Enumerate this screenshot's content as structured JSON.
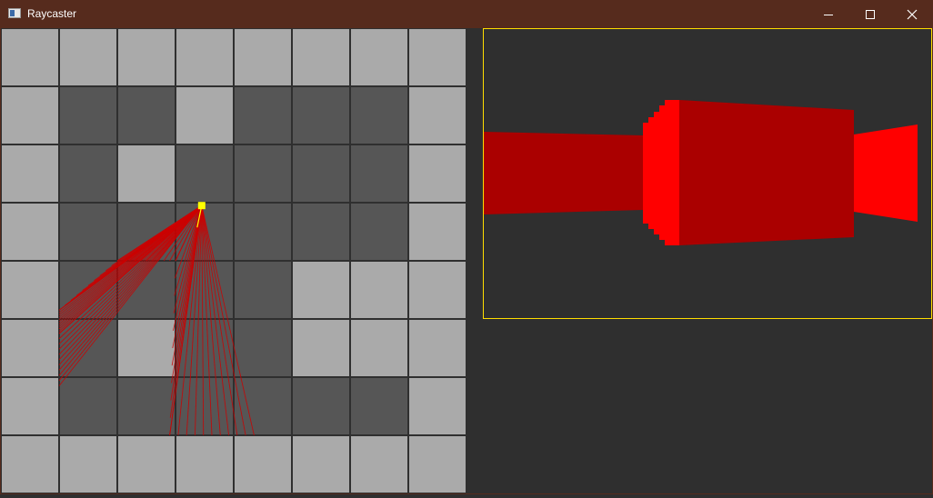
{
  "window": {
    "title": "Raycaster",
    "controls": {
      "minimize": "minimize-icon",
      "maximize": "maximize-icon",
      "close": "close-icon"
    }
  },
  "colors": {
    "titlebar": "#562b1d",
    "background": "#2f2f2f",
    "wall_cell": "#aaaaaa",
    "floor_cell": "#565656",
    "grid_line": "#2f2f2f",
    "player": "#ffff00",
    "ray": "#cc0000",
    "wall_near": "#ff0000",
    "wall_far": "#aa0000",
    "viewport_border": "#ffdd00"
  },
  "map": {
    "rows": 8,
    "cols": 8,
    "grid": [
      [
        1,
        1,
        1,
        1,
        1,
        1,
        1,
        1
      ],
      [
        1,
        0,
        0,
        1,
        0,
        0,
        0,
        1
      ],
      [
        1,
        0,
        1,
        0,
        0,
        0,
        0,
        1
      ],
      [
        1,
        0,
        0,
        0,
        0,
        0,
        0,
        1
      ],
      [
        1,
        0,
        0,
        0,
        0,
        1,
        1,
        1
      ],
      [
        1,
        0,
        1,
        0,
        0,
        1,
        1,
        1
      ],
      [
        1,
        0,
        0,
        0,
        0,
        0,
        0,
        1
      ],
      [
        1,
        1,
        1,
        1,
        1,
        1,
        1,
        1
      ]
    ],
    "player": {
      "col": 3.45,
      "row": 3.05
    },
    "ray_hits": [
      {
        "col": 1.0,
        "row": 6.15
      },
      {
        "col": 1.0,
        "row": 5.25
      },
      {
        "col": 1.0,
        "row": 4.85
      },
      {
        "col": 2.0,
        "row": 4.0
      },
      {
        "col": 3.0,
        "row": 4.0
      },
      {
        "col": 2.9,
        "row": 7.0
      },
      {
        "col": 4.35,
        "row": 7.0
      }
    ]
  }
}
